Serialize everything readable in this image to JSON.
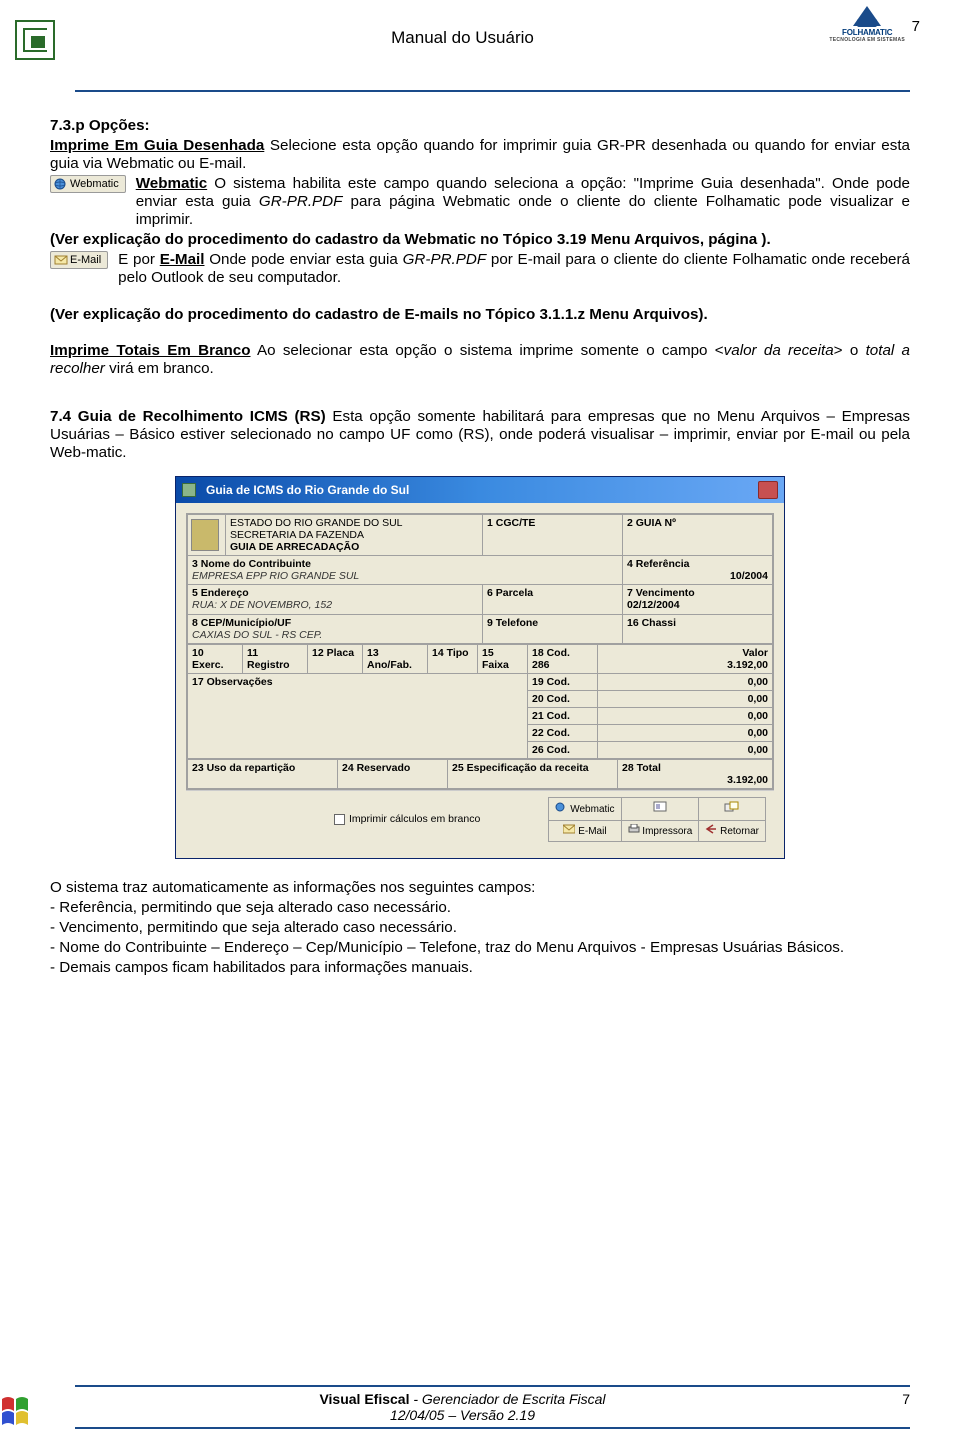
{
  "header": {
    "title": "Manual do Usuário",
    "page_number_top": "7",
    "logo_text": "FOLHAMATIC",
    "logo_tag": "TECNOLOGIA EM SISTEMAS"
  },
  "section_opcoes": {
    "heading": "7.3.p Opções:",
    "imprime_guia_label": "Imprime Em Guia Desenhada",
    "imprime_guia_text": " Selecione esta opção quando for imprimir guia GR-PR desenhada ou quando for enviar esta guia via Webmatic ou E-mail.",
    "webmatic_btn": "Webmatic",
    "webmatic_label": "Webmatic",
    "webmatic_text": " O sistema habilita este campo quando seleciona a opção: \"Imprime Guia desenhada\". Onde pode enviar esta guia ",
    "webmatic_file": "GR-PR.PDF",
    "webmatic_text2": " para página Webmatic onde o cliente do cliente Folhamatic pode visualizar e imprimir.",
    "ver_webmatic": "(Ver explicação do procedimento do cadastro da Webmatic no Tópico 3.19 Menu Arquivos, página ).",
    "email_btn": "E-Mail",
    "email_pre": "E por ",
    "email_label": "E-Mail",
    "email_text": " Onde pode enviar esta guia ",
    "email_file": "GR-PR.PDF",
    "email_text2": " por E-mail para o cliente do cliente Folhamatic onde receberá pelo Outlook de seu computador.",
    "ver_email": "(Ver explicação do procedimento do cadastro de E-mails no Tópico 3.1.1.z Menu Arquivos).",
    "totais_label": "Imprime Totais Em Branco",
    "totais_text_a": " Ao selecionar esta opção o sistema imprime somente o campo <",
    "totais_valor": "valor da receita",
    "totais_text_b": "> o ",
    "totais_total": "total a recolher",
    "totais_text_c": " virá em branco."
  },
  "section_74": {
    "heading": "7.4 Guia de Recolhimento ICMS (RS)",
    "text": " Esta opção somente habilitará para empresas que no Menu Arquivos – Empresas Usuárias – Básico estiver selecionado no campo UF como (RS), onde poderá visualisar – imprimir, enviar por E-mail ou pela Web-matic."
  },
  "dialog": {
    "title": "Guia de ICMS do Rio Grande do Sul",
    "hdr1": "ESTADO DO RIO GRANDE DO SUL",
    "hdr2": "SECRETARIA DA FAZENDA",
    "hdr3": "GUIA DE ARRECADAÇÃO",
    "f1": "1 CGC/TE",
    "f2": "2 GUIA Nº",
    "f3": "3 Nome do Contribuinte",
    "f3v": "EMPRESA EPP RIO GRANDE SUL",
    "f4": "4 Referência",
    "f4v": "10/2004",
    "f5": "5 Endereço",
    "f5v": "RUA: X DE NOVEMBRO, 152",
    "f6": "6 Parcela",
    "f7": "7 Vencimento",
    "f7v": "02/12/2004",
    "f8": "8 CEP/Município/UF",
    "f8v": "CAXIAS DO SUL - RS  CEP.",
    "f9": "9 Telefone",
    "f16": "16 Chassi",
    "f10": "10 Exerc.",
    "f11": "11 Registro",
    "f12": "12 Placa",
    "f13": "13 Ano/Fab.",
    "f14": "14 Tipo",
    "f15": "15 Faixa",
    "f18": "18 Cod.",
    "f18v": "286",
    "fval": "Valor",
    "fvalv": "3.192,00",
    "f17": "17 Observações",
    "f19": "19 Cod.",
    "f20": "20 Cod.",
    "f21": "21 Cod.",
    "f22": "22 Cod.",
    "f26": "26 Cod.",
    "zero": "0,00",
    "f23": "23 Uso da repartição",
    "f24": "24 Reservado",
    "f25": "25 Especificação da receita",
    "f28": "28 Total",
    "f28v": "3.192,00",
    "chk_label": "Imprimir cálculos em branco",
    "btn_webmatic": "Webmatic",
    "btn_printicon": "",
    "btn_visualizar": "",
    "btn_email": "E-Mail",
    "btn_impressora": "Impressora",
    "btn_retornar": "Retornar"
  },
  "post_text": {
    "l1": "O sistema traz automaticamente as informações nos seguintes campos:",
    "l2": "- Referência, permitindo que seja alterado caso necessário.",
    "l3": "- Vencimento, permitindo que seja alterado caso necessário.",
    "l4": "- Nome do Contribuinte – Endereço – Cep/Município – Telefone, traz do Menu Arquivos - Empresas Usuárias Básicos.",
    "l5": "- Demais campos ficam habilitados para informações manuais."
  },
  "footer": {
    "product": "Visual Efiscal",
    "desc": " - Gerenciador de Escrita Fiscal",
    "version": "12/04/05 – Versão 2.19",
    "page": "7"
  }
}
